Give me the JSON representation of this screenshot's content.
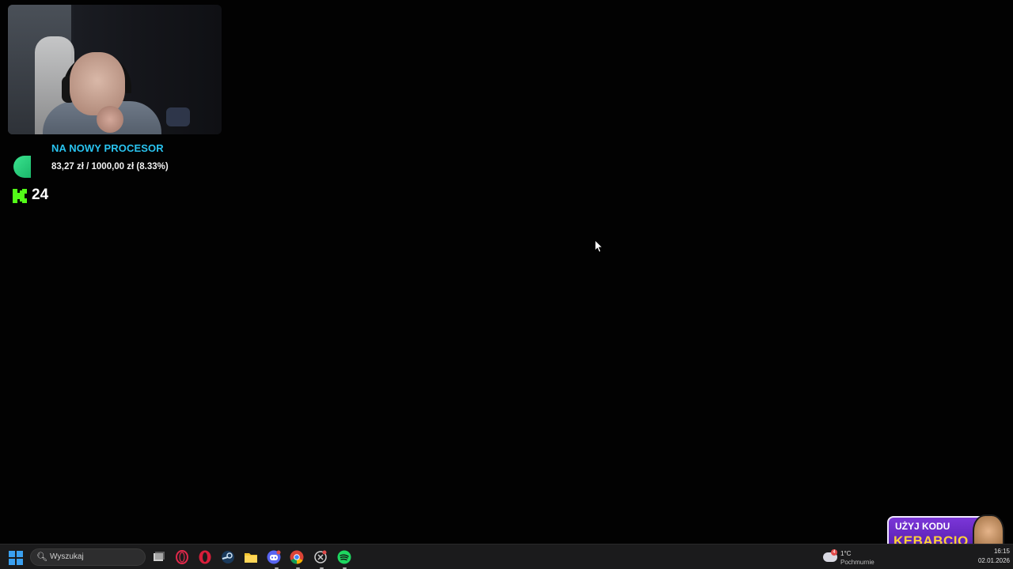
{
  "overlay": {
    "goal": {
      "title": "NA NOWY PROCESOR",
      "progress_text": "83,27 zł / 1000,00 zł (8.33%)",
      "progress_fraction": 0.0833,
      "accent_color": "#29c4f0",
      "icon_color": "#2fd47c"
    },
    "kick": {
      "viewers": "24",
      "logo_color": "#53fc18"
    },
    "promo": {
      "line1": "UŻYJ KODU",
      "line2": "KEBABCIO"
    }
  },
  "taskbar": {
    "search_placeholder": "Wyszukaj",
    "apps": [
      {
        "name": "task-view-icon"
      },
      {
        "name": "opera-gx-icon"
      },
      {
        "name": "opera-icon"
      },
      {
        "name": "steam-icon"
      },
      {
        "name": "file-explorer-icon"
      },
      {
        "name": "discord-icon"
      },
      {
        "name": "chrome-icon"
      },
      {
        "name": "app-icon"
      },
      {
        "name": "spotify-icon"
      }
    ],
    "weather": {
      "badge": "4",
      "temp": "1°C",
      "description": "Pochmurnie"
    },
    "clock": {
      "time": "16:15",
      "date": "02.01.2026"
    }
  }
}
